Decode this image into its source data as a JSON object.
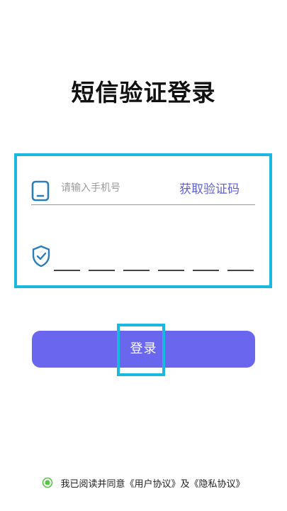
{
  "page": {
    "title": "短信验证登录"
  },
  "form": {
    "phone_placeholder": "请输入手机号",
    "get_code_label": "获取验证码",
    "code_digits": [
      "",
      "",
      "",
      "",
      "",
      ""
    ]
  },
  "login": {
    "label": "登录"
  },
  "agreement": {
    "prefix": "我已阅读并同意",
    "user_agreement": "《用户协议》",
    "and": "及",
    "privacy_policy": "《隐私协议》",
    "checked": true
  },
  "icons": {
    "phone": "phone-icon",
    "shield": "shield-check-icon",
    "radio": "radio-checked-icon"
  },
  "colors": {
    "accent": "#6a67ee",
    "link": "#5c5fd6",
    "highlight": "#1ab7e0",
    "icon": "#2a7fb8",
    "radio": "#5ac44a"
  }
}
